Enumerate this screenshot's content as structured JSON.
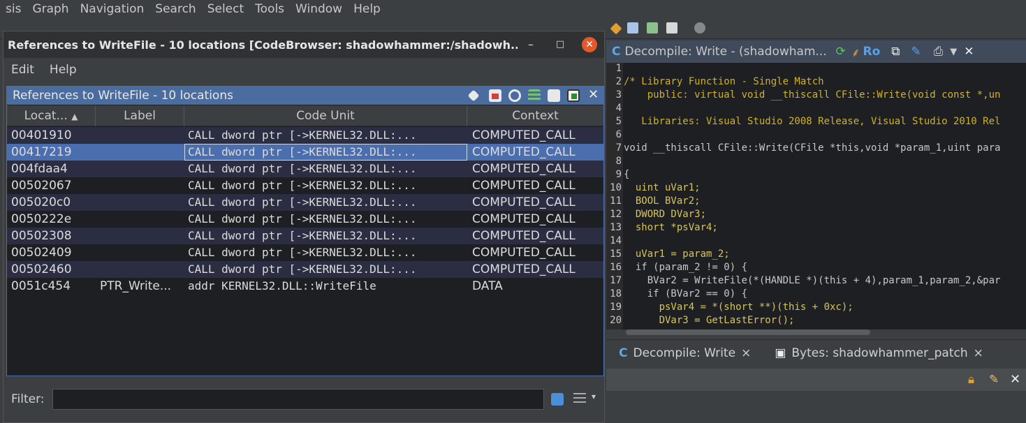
{
  "menubar": [
    "sis",
    "Graph",
    "Navigation",
    "Search",
    "Select",
    "Tools",
    "Window",
    "Help"
  ],
  "dialog": {
    "title": "References to WriteFile - 10 locations [CodeBrowser: shadowhammer:/shadowh...",
    "minimize": "–",
    "maximize": "□",
    "close": "✕",
    "menu": [
      "Edit",
      "Help"
    ],
    "panel_title": "References to WriteFile - 10 locations",
    "panel_close": "✕",
    "columns": [
      "Locat...",
      "Label",
      "Code Unit",
      "Context"
    ],
    "rows": [
      {
        "loc": "00401910",
        "label": "",
        "code": "CALL dword ptr [->KERNEL32.DLL:...",
        "ctx": "COMPUTED_CALL"
      },
      {
        "loc": "00417219",
        "label": "",
        "code": "CALL dword ptr [->KERNEL32.DLL:...",
        "ctx": "COMPUTED_CALL"
      },
      {
        "loc": "004fdaa4",
        "label": "",
        "code": "CALL dword ptr [->KERNEL32.DLL:...",
        "ctx": "COMPUTED_CALL"
      },
      {
        "loc": "00502067",
        "label": "",
        "code": "CALL dword ptr [->KERNEL32.DLL:...",
        "ctx": "COMPUTED_CALL"
      },
      {
        "loc": "005020c0",
        "label": "",
        "code": "CALL dword ptr [->KERNEL32.DLL:...",
        "ctx": "COMPUTED_CALL"
      },
      {
        "loc": "0050222e",
        "label": "",
        "code": "CALL dword ptr [->KERNEL32.DLL:...",
        "ctx": "COMPUTED_CALL"
      },
      {
        "loc": "00502308",
        "label": "",
        "code": "CALL dword ptr [->KERNEL32.DLL:...",
        "ctx": "COMPUTED_CALL"
      },
      {
        "loc": "00502409",
        "label": "",
        "code": "CALL dword ptr [->KERNEL32.DLL:...",
        "ctx": "COMPUTED_CALL"
      },
      {
        "loc": "00502460",
        "label": "",
        "code": "CALL dword ptr [->KERNEL32.DLL:...",
        "ctx": "COMPUTED_CALL"
      },
      {
        "loc": "0051c454",
        "label": "PTR_Write...",
        "code": "addr KERNEL32.DLL::WriteFile",
        "ctx": "DATA"
      }
    ],
    "filter_label": "Filter:"
  },
  "decompiler": {
    "tab_title": "Decompile: Write -  (shadowham...",
    "tab_ro": "Ro",
    "lines": [
      "",
      "/* Library Function - Single Match",
      "    public: virtual void __thiscall CFile::Write(void const *,un",
      "",
      "   Libraries: Visual Studio 2008 Release, Visual Studio 2010 Rel",
      "",
      "void __thiscall CFile::Write(CFile *this,void *param_1,uint para",
      "",
      "{",
      "  uint uVar1;",
      "  BOOL BVar2;",
      "  DWORD DVar3;",
      "  short *psVar4;",
      "",
      "  uVar1 = param_2;",
      "  if (param_2 != 0) {",
      "    BVar2 = WriteFile(*(HANDLE *)(this + 4),param_1,param_2,&par",
      "    if (BVar2 == 0) {",
      "      psVar4 = *(short **)(this + 0xc);",
      "      DVar3 = GetLastError();"
    ]
  },
  "bottom_tabs": [
    {
      "label": "Decompile: Write",
      "close": "×"
    },
    {
      "label": "Bytes: shadowhammer_patch",
      "close": "×"
    }
  ],
  "colors": {
    "selection": "#4b6eaf",
    "accent": "#e25a2a"
  }
}
